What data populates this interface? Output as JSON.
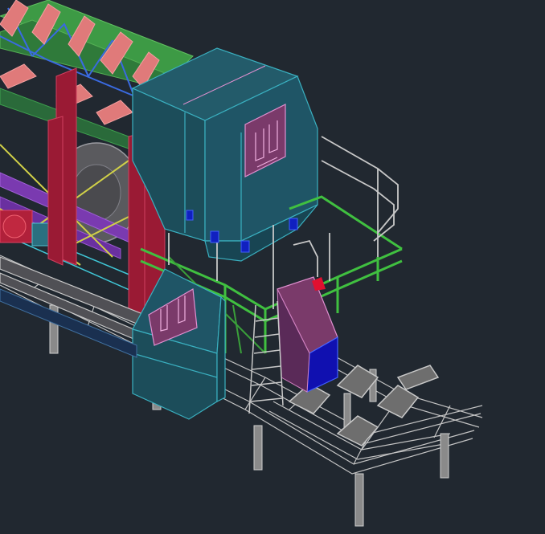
{
  "viewport": {
    "background": "#212830",
    "model_colors": {
      "teal_housing": "#1e4f5d",
      "teal_dark": "#173f4a",
      "magenta_panel": "#7a3a6a",
      "pink_idlers": "#e07a7a",
      "green_platform": "#3aa83a",
      "gray_structure": "#b8b8b8",
      "red_columns": "#b0203a",
      "blue_box": "#1010b0",
      "yellow_braces": "#c8c840",
      "purple_frame": "#7a3ab0",
      "cyan_lines": "#40c8d8",
      "dark_green_beam": "#2a6a3a"
    }
  }
}
